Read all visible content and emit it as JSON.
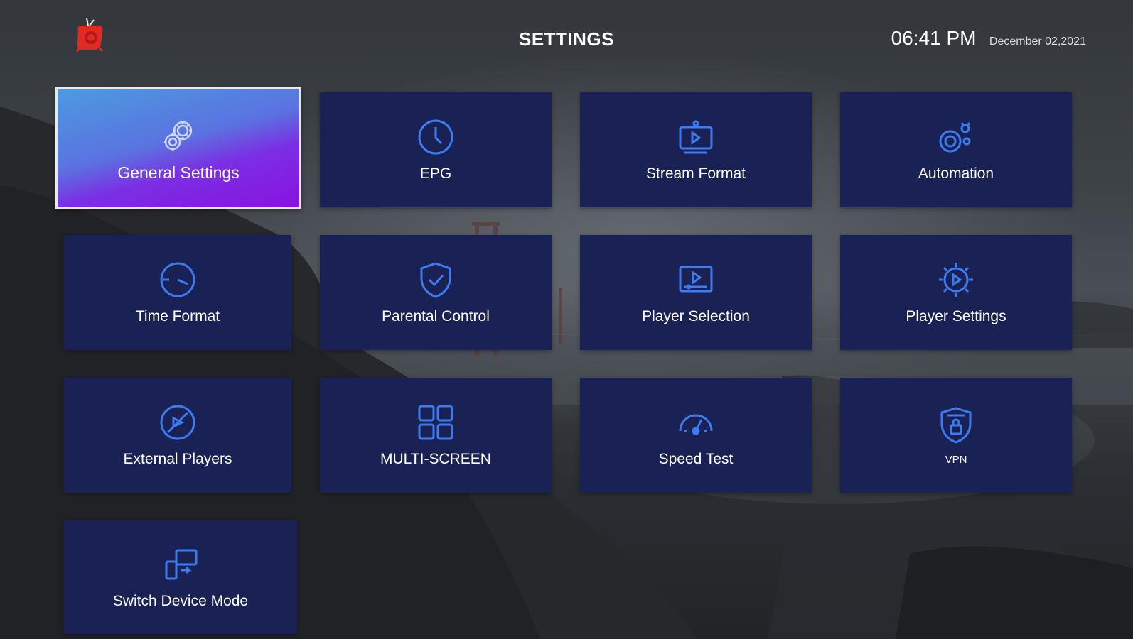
{
  "header": {
    "title": "SETTINGS",
    "time": "06:41 PM",
    "date": "December 02,2021"
  },
  "tiles": [
    {
      "label": "General Settings",
      "icon": "gears-icon",
      "active": true
    },
    {
      "label": "EPG",
      "icon": "clock-icon"
    },
    {
      "label": "Stream Format",
      "icon": "stream-format-icon"
    },
    {
      "label": "Automation",
      "icon": "automation-icon"
    },
    {
      "label": "Time Format",
      "icon": "time-format-icon"
    },
    {
      "label": "Parental Control",
      "icon": "shield-check-icon"
    },
    {
      "label": "Player Selection",
      "icon": "player-selection-icon"
    },
    {
      "label": "Player Settings",
      "icon": "player-settings-icon"
    },
    {
      "label": "External Players",
      "icon": "external-players-icon"
    },
    {
      "label": "MULTI-SCREEN",
      "icon": "multi-screen-icon"
    },
    {
      "label": "Speed Test",
      "icon": "speedometer-icon"
    },
    {
      "label": "VPN",
      "icon": "vpn-icon"
    },
    {
      "label": "Switch Device Mode",
      "icon": "switch-device-icon"
    }
  ],
  "colors": {
    "tile_background": "#1a2255",
    "icon_blue": "#3d7cf0",
    "active_gradient_start": "#4c9be0",
    "active_gradient_end": "#8a12e0",
    "logo_red": "#e02a22"
  }
}
